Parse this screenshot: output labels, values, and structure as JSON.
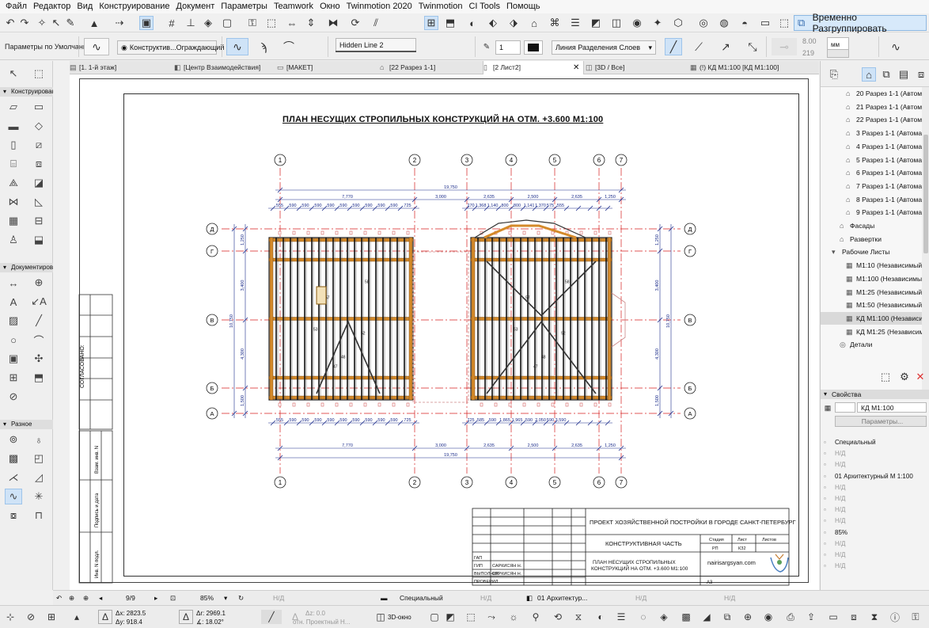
{
  "menu": [
    "Файл",
    "Редактор",
    "Вид",
    "Конструирование",
    "Документ",
    "Параметры",
    "Teamwork",
    "Окно",
    "Twinmotion 2020",
    "Twinmotion",
    "CI Tools",
    "Помощь"
  ],
  "toolbar": {
    "ungroup_label": "Временно Разгруппировать",
    "icons": [
      "undo-icon",
      "redo-icon",
      "magic-wand-icon",
      "arrow-icon",
      "pointer-icon",
      "select-icon",
      "grid-icon",
      "guide-icon",
      "snap-icon",
      "layer-icon",
      "pen-icon",
      "align-icon"
    ]
  },
  "infobox": {
    "defaults_label": "Параметры по Умолчанию",
    "structure_label": "Конструктив...Ограждающий",
    "pen_style": "Hidden Line 2",
    "line_weight": "1",
    "layer_line": "Линия Разделения Слоев",
    "dim_value_1": "8.00",
    "dim_value_2": "219",
    "unit": "мм"
  },
  "tabs": [
    {
      "label": "[1. 1-й этаж]",
      "icon": "floor-plan-icon"
    },
    {
      "label": "[Центр Взаимодействия]",
      "icon": "collab-icon"
    },
    {
      "label": "[МАКЕТ]",
      "icon": "layout-icon"
    },
    {
      "label": "[22 Разрез 1-1]",
      "icon": "section-icon"
    },
    {
      "label": "[2 Лист2]",
      "icon": "sheet-icon"
    },
    {
      "label": "[3D / Все]",
      "icon": "3d-icon"
    },
    {
      "label": "(!) КД М1:100 [КД М1:100]",
      "icon": "worksheet-icon"
    }
  ],
  "toolbox": {
    "sections": [
      "Конструирование",
      "Документирование",
      "Разное"
    ]
  },
  "drawing": {
    "title": "ПЛАН НЕСУЩИХ СТРОПИЛЬНЫХ КОНСТРУКЦИЙ НА ОТМ.  +3.600  М1:100",
    "axis_numbers": [
      "1",
      "2",
      "3",
      "4",
      "5",
      "6",
      "7"
    ],
    "axis_letters": [
      "Д",
      "Г",
      "В",
      "Б",
      "А"
    ],
    "dims_top_total": "19,750",
    "dims_top_row": [
      "7,770",
      "3,000",
      "2,635",
      "2,500",
      "2,635",
      "1,250"
    ],
    "dims_bottom_row": [
      "7,770",
      "3,000",
      "2,635",
      "2,500",
      "2,635",
      "1,250"
    ],
    "dims_bottom_total": "19,750",
    "dims_side": [
      "1,250",
      "3,400",
      "10,750",
      "4,300",
      "1,500"
    ],
    "agreed_label": "СОГЛАСОВАНО:"
  },
  "title_block": {
    "project": "ПРОЕКТ ХОЗЯЙСТВЕННОЙ ПОСТРОЙКИ В ГОРОДЕ САНКТ-ПЕТЕРБУРГ",
    "part": "КОНСТРУКТИВНАЯ ЧАСТЬ",
    "sheet_title": "ПЛАН НЕСУЩИХ СТРОПИЛЬНЫХ КОНСТРУКЦИЙ НА ОТМ. +3.600  М1:100",
    "stage_label": "Стадия",
    "sheet_label": "Лист",
    "sheets_label": "Листов",
    "stage_value": "РП",
    "sheet_value": "КЗ2",
    "site": "nairisargsyan.com",
    "format": "А3",
    "roles": [
      {
        "role": "ГАП",
        "name": ""
      },
      {
        "role": "ГИП",
        "name": "САРКИСЯН Н."
      },
      {
        "role": "ВЫПОЛНИЛ",
        "name": "САРКИСЯН Н."
      },
      {
        "role": "ПРОВЕРИЛ",
        "name": ""
      }
    ],
    "side_labels": [
      "Взам. инв. N",
      "Подпись и дата",
      "Инв. N подл."
    ]
  },
  "navigator": {
    "items": [
      {
        "label": "20 Разрез 1-1 (Автома",
        "indent": 2,
        "icon": "section-icon"
      },
      {
        "label": "21 Разрез 1-1 (Автома",
        "indent": 2,
        "icon": "section-icon"
      },
      {
        "label": "22 Разрез 1-1 (Автома",
        "indent": 2,
        "icon": "section-icon"
      },
      {
        "label": "3 Разрез 1-1 (Автома",
        "indent": 2,
        "icon": "section-icon"
      },
      {
        "label": "4 Разрез 1-1 (Автома",
        "indent": 2,
        "icon": "section-icon"
      },
      {
        "label": "5 Разрез 1-1 (Автома",
        "indent": 2,
        "icon": "section-icon"
      },
      {
        "label": "6 Разрез 1-1 (Автома",
        "indent": 2,
        "icon": "section-icon"
      },
      {
        "label": "7 Разрез 1-1 (Автома",
        "indent": 2,
        "icon": "section-icon"
      },
      {
        "label": "8 Разрез 1-1 (Автома",
        "indent": 2,
        "icon": "section-icon"
      },
      {
        "label": "9 Разрез 1-1 (Автома",
        "indent": 2,
        "icon": "section-icon"
      },
      {
        "label": "Фасады",
        "indent": 1,
        "icon": "facade-icon"
      },
      {
        "label": "Развертки",
        "indent": 1,
        "icon": "elevation-icon"
      },
      {
        "label": "Рабочие Листы",
        "indent": 0,
        "icon": "worksheet-folder-icon"
      },
      {
        "label": "М1:10 (Независимый)",
        "indent": 2,
        "icon": "worksheet-icon"
      },
      {
        "label": "М1:100 (Независимый",
        "indent": 2,
        "icon": "worksheet-icon"
      },
      {
        "label": "М1:25 (Независимый)",
        "indent": 2,
        "icon": "worksheet-icon"
      },
      {
        "label": "М1:50 (Независимый)",
        "indent": 2,
        "icon": "worksheet-icon"
      },
      {
        "label": "КД М1:100 (Независи",
        "indent": 2,
        "icon": "worksheet-icon",
        "selected": true
      },
      {
        "label": "КД М1:25 (Независим",
        "indent": 2,
        "icon": "worksheet-icon"
      },
      {
        "label": "Детали",
        "indent": 1,
        "icon": "details-icon"
      }
    ]
  },
  "properties": {
    "header": "Свойства",
    "name_value": "КД М1:100",
    "params_button": "Параметры...",
    "rows": [
      {
        "text": "Специальный",
        "dim": false
      },
      {
        "text": "Н/Д",
        "dim": true
      },
      {
        "text": "Н/Д",
        "dim": true
      },
      {
        "text": "01 Архитектурный М 1:100",
        "dim": false
      },
      {
        "text": "Н/Д",
        "dim": true
      },
      {
        "text": "Н/Д",
        "dim": true
      },
      {
        "text": "Н/Д",
        "dim": true
      },
      {
        "text": "Н/Д",
        "dim": true
      },
      {
        "text": "85%",
        "dim": false
      },
      {
        "text": "Н/Д",
        "dim": true
      },
      {
        "text": "Н/Д",
        "dim": true
      },
      {
        "text": "Н/Д",
        "dim": true
      }
    ]
  },
  "status": {
    "page": "9/9",
    "zoom": "85%",
    "nd1": "Н/Д",
    "structure": "Специальный",
    "nd2": "Н/Д",
    "layer_combo": "01 Архитектур...",
    "nd3": "Н/Д",
    "nd4": "Н/Д"
  },
  "coords": {
    "dx": "Δx: 2823.5",
    "dy": "Δy: 918.4",
    "dr": "Δr: 2969.1",
    "angle": "∡: 18.02°",
    "dz": "Δz: 0.0",
    "ref": "отн. Проектный Н...",
    "view3d": "3D-окно"
  }
}
